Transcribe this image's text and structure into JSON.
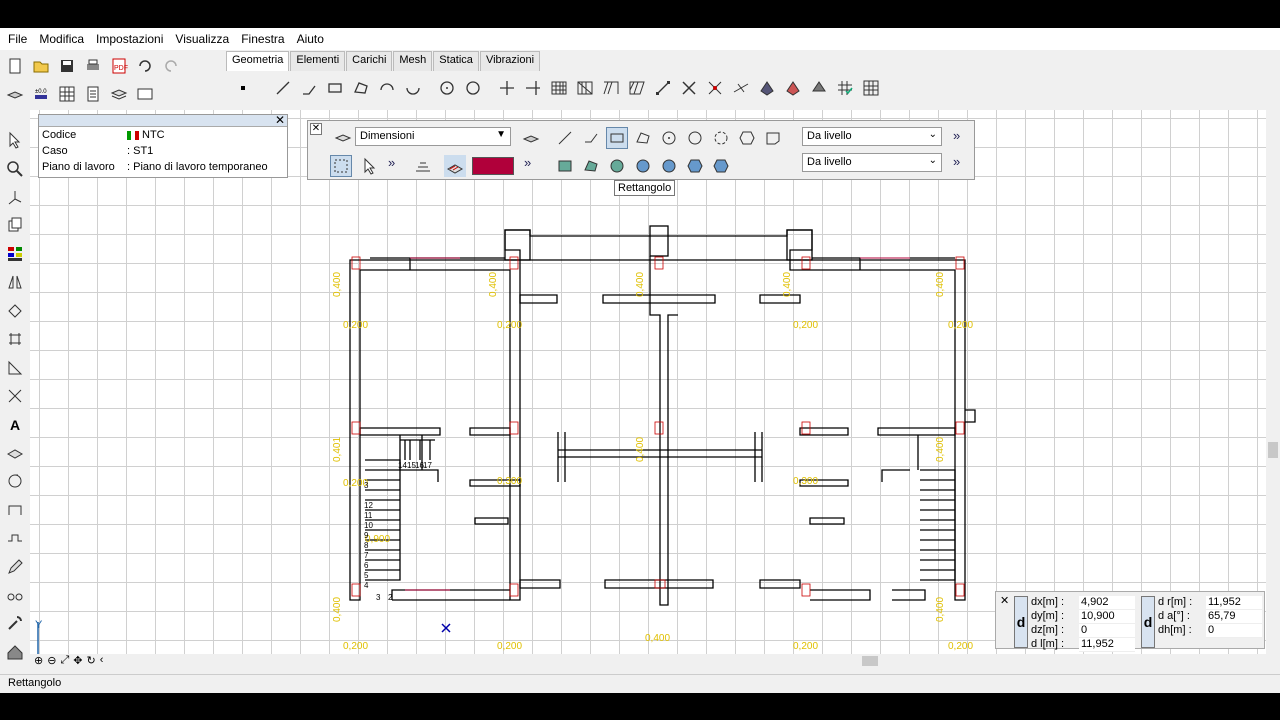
{
  "menu": [
    "File",
    "Modifica",
    "Impostazioni",
    "Visualizza",
    "Finestra",
    "Aiuto"
  ],
  "tabs": [
    "Geometria",
    "Elementi",
    "Carichi",
    "Mesh",
    "Statica",
    "Vibrazioni"
  ],
  "active_tab": "Geometria",
  "info": {
    "rows": [
      {
        "k": "Codice",
        "v": "NTC"
      },
      {
        "k": "Caso",
        "v": ": ST1"
      },
      {
        "k": "Piano di lavoro",
        "v": ": Piano di lavoro temporaneo"
      }
    ]
  },
  "floatbar": {
    "dropdown_main": "Dimensioni",
    "dropdown_level1": "Da livello",
    "dropdown_level2": "Da livello",
    "fill_color": "#b0003a"
  },
  "tooltip": "Rettangolo",
  "coords": {
    "left": [
      {
        "label": "dx[m] :",
        "value": "4,902"
      },
      {
        "label": "dy[m] :",
        "value": "10,900"
      },
      {
        "label": "dz[m] :",
        "value": "0"
      },
      {
        "label": "d l[m] :",
        "value": "11,952"
      }
    ],
    "right": [
      {
        "label": "d r[m] :",
        "value": "11,952"
      },
      {
        "label": "d a[°] :",
        "value": "65,79"
      },
      {
        "label": "dh[m] :",
        "value": "0"
      }
    ],
    "dletter": "d"
  },
  "status": "Rettangolo",
  "axis": {
    "x": "X",
    "y": "Y"
  },
  "dims": {
    "col_labels": [
      "0,400",
      "0,400",
      "0,400",
      "0,400",
      "0,400",
      "0,401",
      "0,400",
      "0,400",
      "0,400",
      "0,400"
    ],
    "small_labels": [
      "0,200",
      "0,200",
      "0,200",
      "0,200",
      "0,200",
      "0,300",
      "0,300",
      "0,400",
      "0,200",
      "0,200",
      "0,200",
      "0,200"
    ],
    "stair": [
      "14",
      "15",
      "16",
      "17",
      "3",
      "12",
      "11",
      "10",
      "9",
      "8",
      "7",
      "6",
      "5",
      "4",
      "3",
      "2"
    ],
    "stair_label": "0,900"
  },
  "colors": {
    "grid": "#d0d0d0",
    "dim": "#e0c000",
    "wall": "#000000",
    "accent": "#b0003a"
  }
}
